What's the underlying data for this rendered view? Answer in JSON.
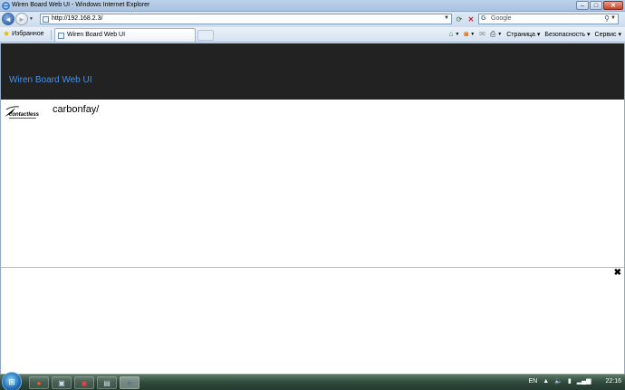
{
  "window": {
    "title": "Wiren Board Web UI - Windows Internet Explorer",
    "minimize_label": "–",
    "maximize_label": "□",
    "close_label": "✕"
  },
  "addressbar": {
    "url": "http://192.168.2.3/",
    "search_placeholder": "Google",
    "search_engine_glyph": "G"
  },
  "commandbar": {
    "favorites_label": "Избранное",
    "tab_title": "Wiren Board Web UI",
    "page_menu": "Страница",
    "safety_menu": "Безопасность",
    "tools_menu": "Сервис"
  },
  "page": {
    "brand": "Wiren Board Web UI",
    "logo_text": "contactless",
    "widget_title": "carbonfay/",
    "close_glyph": "✖"
  },
  "taskbar": {
    "language": "EN",
    "clock": "22:16"
  },
  "colors": {
    "navbar_bg": "#222222",
    "brand_color": "#4a90e2"
  }
}
